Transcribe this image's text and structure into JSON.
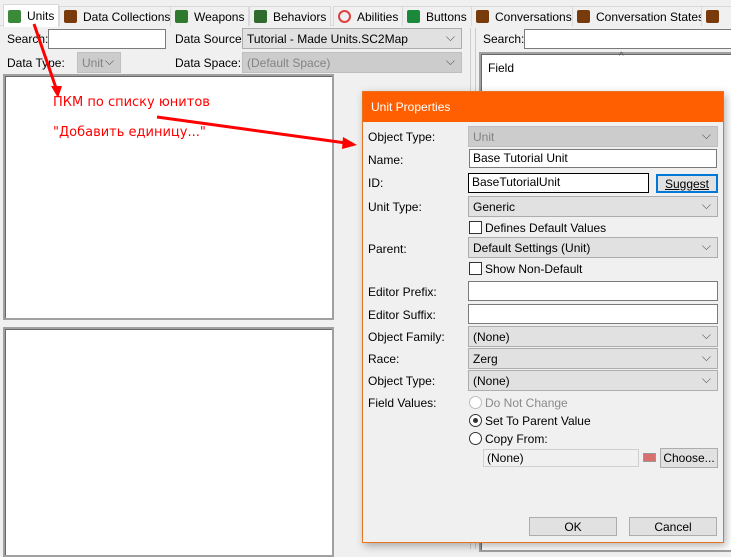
{
  "tabs": [
    {
      "label": "Units",
      "icon": "unit-icon",
      "color": "#3a8a3a"
    },
    {
      "label": "Data Collections",
      "icon": "data-collection-icon",
      "color": "#7a3b0c"
    },
    {
      "label": "Weapons",
      "icon": "weapon-icon",
      "color": "#2f7a2f"
    },
    {
      "label": "Behaviors",
      "icon": "behavior-icon",
      "color": "#2f6a2f"
    },
    {
      "label": "Abilities",
      "icon": "ability-icon",
      "color": "#e04040"
    },
    {
      "label": "Buttons",
      "icon": "button-icon",
      "color": "#1a8a3a"
    },
    {
      "label": "Conversations",
      "icon": "conversation-icon",
      "color": "#7a3b0c"
    },
    {
      "label": "Conversation States",
      "icon": "conversation-state-icon",
      "color": "#7a3b0c"
    },
    {
      "label": "",
      "icon": "more-tab-icon",
      "color": "#7a3b0c"
    }
  ],
  "left": {
    "search_label": "Search:",
    "search_value": "",
    "data_source_label": "Data Source:",
    "data_source_value": "Tutorial - Made Units.SC2Map",
    "data_type_label": "Data Type:",
    "data_type_value": "Unit",
    "data_space_label": "Data Space:",
    "data_space_value": "(Default Space)"
  },
  "right": {
    "search_label": "Search:",
    "search_value": "",
    "column_header": "Field"
  },
  "annotations": {
    "line1": "ПКМ по списку юнитов",
    "line2": "\"Добавить единицу...\"",
    "color": "#ff0000"
  },
  "dialog": {
    "title": "Unit Properties",
    "object_type_label": "Object Type:",
    "object_type_value": "Unit",
    "name_label": "Name:",
    "name_value": "Base Tutorial Unit",
    "id_label": "ID:",
    "id_value": "BaseTutorialUnit",
    "suggest": "Suggest",
    "unit_type_label": "Unit Type:",
    "unit_type_value": "Generic",
    "defines_default": "Defines Default Values",
    "parent_label": "Parent:",
    "parent_value": "Default Settings (Unit)",
    "show_non_default": "Show Non-Default",
    "editor_prefix_label": "Editor Prefix:",
    "editor_prefix_value": "",
    "editor_suffix_label": "Editor Suffix:",
    "editor_suffix_value": "",
    "object_family_label": "Object Family:",
    "object_family_value": "(None)",
    "race_label": "Race:",
    "race_value": "Zerg",
    "object_type2_label": "Object Type:",
    "object_type2_value": "(None)",
    "field_values_label": "Field Values:",
    "radio_do_not_change": "Do Not Change",
    "radio_set_parent": "Set To Parent Value",
    "radio_copy_from": "Copy From:",
    "copy_from_value": "(None)",
    "choose": "Choose...",
    "ok": "OK",
    "cancel": "Cancel",
    "accent": "#ff5f00"
  }
}
